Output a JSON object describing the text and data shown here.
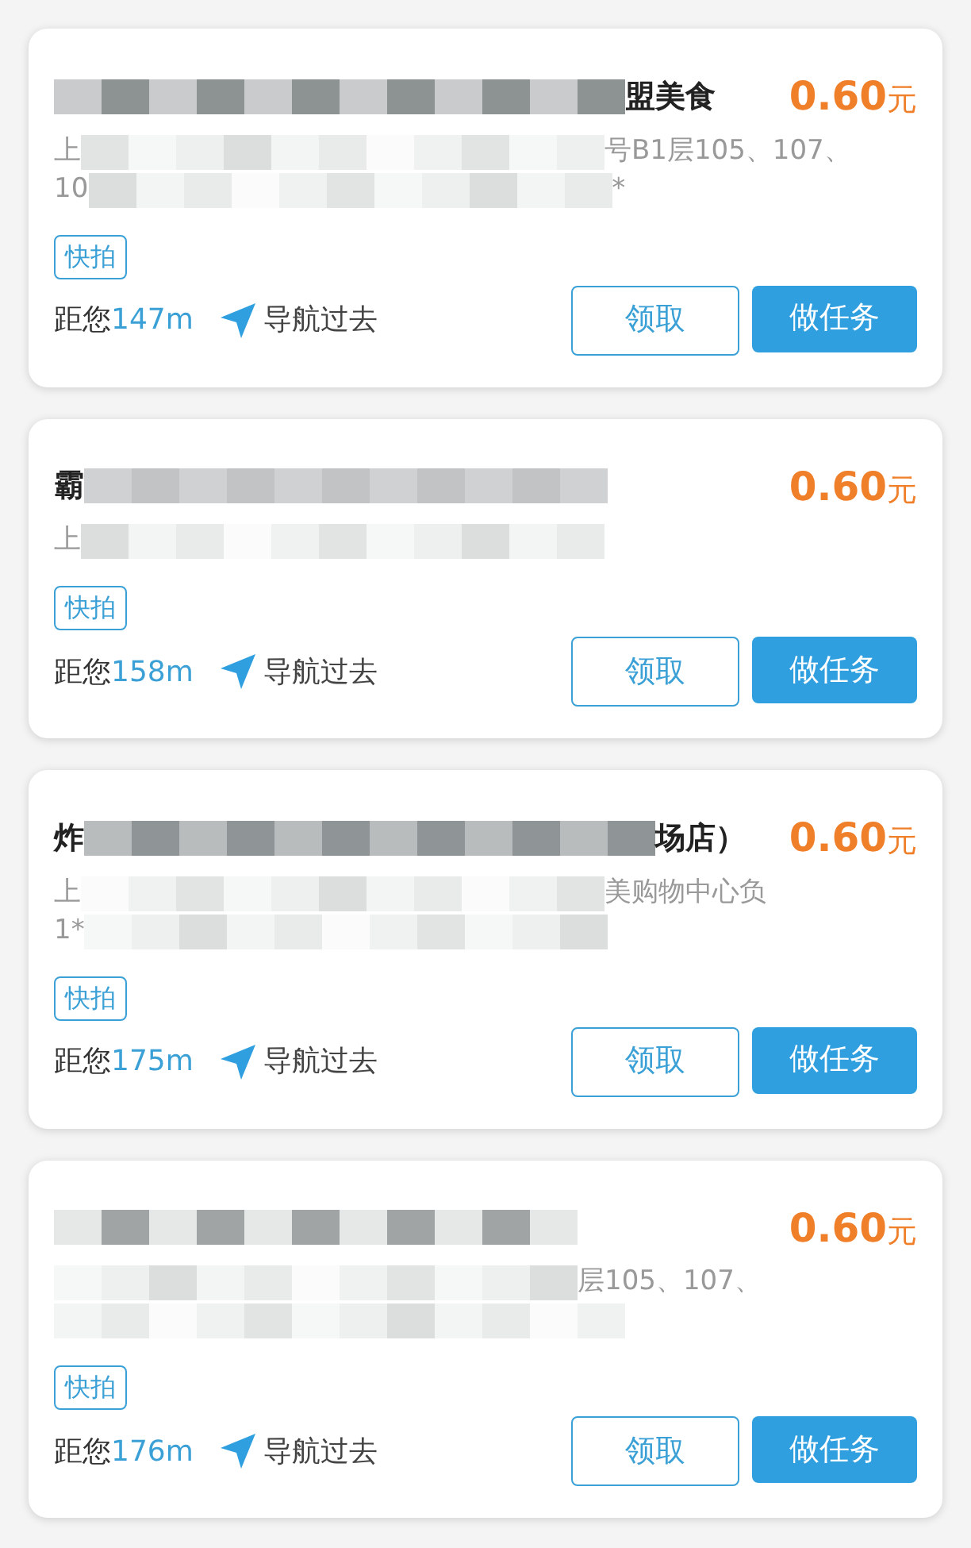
{
  "tasks": [
    {
      "title": {
        "after": "盟美食"
      },
      "price": "0.60",
      "unit": "元",
      "address": [
        {
          "before": "上",
          "after": "号B1层105、107、"
        },
        {
          "before": "10",
          "after": "*"
        }
      ],
      "tag": "快拍",
      "distance_label": "距您",
      "distance": "147m",
      "navigate": "导航过去",
      "claim": "领取",
      "do_task": "做任务"
    },
    {
      "title": {
        "before": "霸"
      },
      "price": "0.60",
      "unit": "元",
      "address": [
        {
          "before": "上"
        }
      ],
      "tag": "快拍",
      "distance_label": "距您",
      "distance": "158m",
      "navigate": "导航过去",
      "claim": "领取",
      "do_task": "做任务"
    },
    {
      "title": {
        "before": "炸",
        "after": "场店）"
      },
      "price": "0.60",
      "unit": "元",
      "address": [
        {
          "before": "上",
          "after": "美购物中心负"
        },
        {
          "before": "1*"
        }
      ],
      "tag": "快拍",
      "distance_label": "距您",
      "distance": "175m",
      "navigate": "导航过去",
      "claim": "领取",
      "do_task": "做任务"
    },
    {
      "title": {
        "kind": "hidden"
      },
      "price": "0.60",
      "unit": "元",
      "address": [
        {
          "kind": "partly_hidden",
          "after": "层105、107、"
        },
        {
          "kind": "hidden"
        }
      ],
      "tag": "快拍",
      "distance_label": "距您",
      "distance": "176m",
      "navigate": "导航过去",
      "claim": "领取",
      "do_task": "做任务"
    }
  ]
}
